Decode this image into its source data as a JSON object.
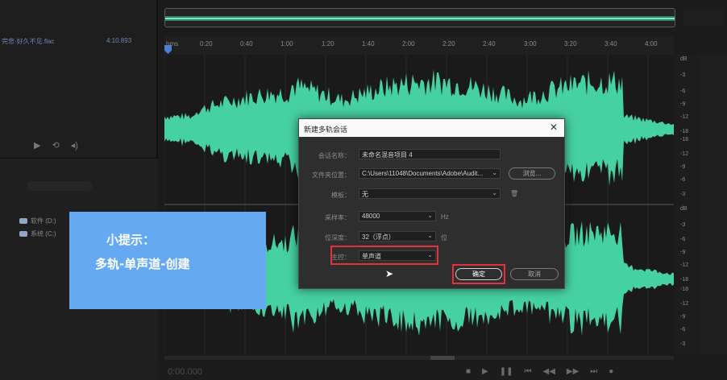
{
  "left_panel": {
    "file_name": "完悲·好久不见.flac",
    "file_duration": "4:10.893",
    "drives": [
      {
        "label": "软件 (D:)"
      },
      {
        "label": "系统 (C:)"
      }
    ]
  },
  "ruler": {
    "ticks": [
      "hms",
      "0:20",
      "0:40",
      "1:00",
      "1:20",
      "1:40",
      "2:00",
      "2:20",
      "2:40",
      "3:00",
      "3:20",
      "3:40",
      "4:00"
    ]
  },
  "db_scale": {
    "top_channel": [
      "dB",
      "-3",
      "-6",
      "-9",
      "-12",
      "-18",
      "-18",
      "-12",
      "-9",
      "-6",
      "-3"
    ],
    "bottom_channel": [
      "dB",
      "-3",
      "-6",
      "-9",
      "-12",
      "-18",
      "-18",
      "-12",
      "-9",
      "-6",
      "-3"
    ]
  },
  "tip": {
    "line1": "小提示：",
    "line2": "多轨-单声道-创建"
  },
  "dialog": {
    "title": "新建多轨会话",
    "close": "✕",
    "fields": {
      "session_name_label": "会话名称：",
      "session_name": "未命名混音项目 4",
      "folder_label": "文件夹位置：",
      "folder": "C:\\Users\\11048\\Documents\\Adobe\\Audit...",
      "browse": "浏览...",
      "template_label": "模板：",
      "template": "无",
      "sample_rate_label": "采样率：",
      "sample_rate": "48000",
      "sample_rate_unit": "Hz",
      "bit_depth_label": "位深度：",
      "bit_depth": "32（浮点）",
      "bit_depth_unit": "位",
      "master_label": "主控：",
      "master": "单声道"
    },
    "ok": "确定",
    "cancel": "取消"
  },
  "bottom": {
    "timecode": "0:00.000"
  },
  "colors": {
    "waveform": "#46d1a3",
    "tip_bg": "#65a9f3",
    "highlight": "#e4313c"
  }
}
